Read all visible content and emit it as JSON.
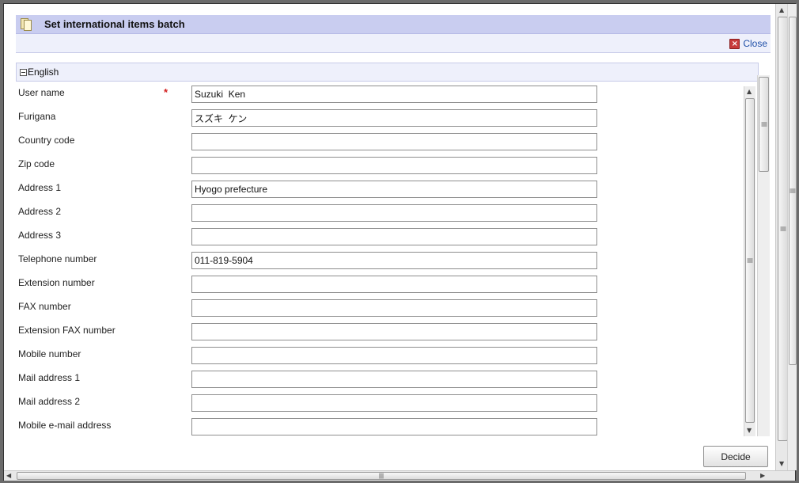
{
  "dialog": {
    "title": "Set international items batch",
    "close_label": "Close",
    "decide_label": "Decide"
  },
  "section": {
    "title": "English",
    "expanded": true
  },
  "form": {
    "required_marker": "*",
    "fields": [
      {
        "label": "User name",
        "value": "Suzuki  Ken",
        "required": true
      },
      {
        "label": "Furigana",
        "value": "スズキ  ケン",
        "required": false
      },
      {
        "label": "Country code",
        "value": "",
        "required": false
      },
      {
        "label": "Zip code",
        "value": "",
        "required": false
      },
      {
        "label": "Address 1",
        "value": "Hyogo prefecture",
        "required": false
      },
      {
        "label": "Address 2",
        "value": "",
        "required": false
      },
      {
        "label": "Address 3",
        "value": "",
        "required": false
      },
      {
        "label": "Telephone number",
        "value": "011-819-5904",
        "required": false
      },
      {
        "label": "Extension number",
        "value": "",
        "required": false
      },
      {
        "label": "FAX number",
        "value": "",
        "required": false
      },
      {
        "label": "Extension FAX number",
        "value": "",
        "required": false
      },
      {
        "label": "Mobile number",
        "value": "",
        "required": false
      },
      {
        "label": "Mail address 1",
        "value": "",
        "required": false
      },
      {
        "label": "Mail address 2",
        "value": "",
        "required": false
      },
      {
        "label": "Mobile e-mail address",
        "value": "",
        "required": false
      }
    ]
  },
  "colors": {
    "title_bar": "#c9cdf0",
    "link": "#1f4fa8",
    "required": "#d21d1d"
  }
}
